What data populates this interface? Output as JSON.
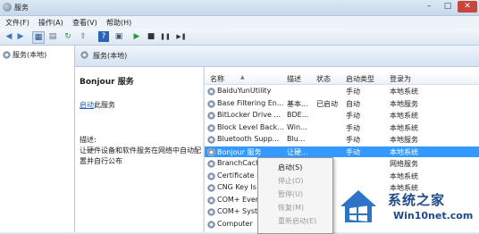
{
  "window": {
    "title": "服务",
    "controls": [
      "–",
      "□",
      "✕"
    ]
  },
  "menu": [
    {
      "label": "文件(F)"
    },
    {
      "label": "操作(A)"
    },
    {
      "label": "查看(V)"
    },
    {
      "label": "帮助(H)"
    }
  ],
  "toolbar": {
    "icons": [
      "back-arrow-icon",
      "forward-arrow-icon",
      "console-tree-icon",
      "show-hide-icon",
      "refresh-icon",
      "export-icon",
      "help-icon",
      "properties-icon",
      "play-icon",
      "stop-icon",
      "pause-icon",
      "restart-icon"
    ],
    "glyphs": [
      "◀",
      "▶",
      "▦",
      "▤",
      "↻",
      "⇪",
      "?",
      "▣",
      "▶",
      "■",
      "❚❚",
      "▶❚"
    ]
  },
  "tree": {
    "item_label": "服务(本地)"
  },
  "header": {
    "label": "服务(本地)"
  },
  "detail": {
    "service_name": "Bonjour 服务",
    "start_link": "启动",
    "start_suffix": "此服务",
    "description_label": "描述:",
    "description_text": "让硬件设备和软件服务在网络中自动配置并自行公布"
  },
  "columns": [
    "名称",
    "描述",
    "状态",
    "启动类型",
    "登录为"
  ],
  "services": [
    {
      "name": "BaiduYunUtility",
      "desc": "",
      "status": "",
      "startup": "手动",
      "logon": "本地系统"
    },
    {
      "name": "Base Filtering En...",
      "desc": "基本...",
      "status": "已启动",
      "startup": "自动",
      "logon": "本地服务"
    },
    {
      "name": "BitLocker Drive ...",
      "desc": "BDE...",
      "status": "",
      "startup": "手动",
      "logon": "本地系统"
    },
    {
      "name": "Block Level Back...",
      "desc": "Win...",
      "status": "",
      "startup": "手动",
      "logon": "本地系统"
    },
    {
      "name": "Bluetooth Supp...",
      "desc": "Blu...",
      "status": "",
      "startup": "手动",
      "logon": "本地服务"
    },
    {
      "name": "Bonjour 服务",
      "desc": "让硬...",
      "status": "",
      "startup": "手动",
      "logon": "本地系统"
    },
    {
      "name": "BranchCach",
      "desc": "",
      "status": "",
      "startup": "",
      "logon": "网络服务"
    },
    {
      "name": "Certificate P",
      "desc": "",
      "status": "",
      "startup": "",
      "logon": "本地系统"
    },
    {
      "name": "CNG Key Is",
      "desc": "",
      "status": "",
      "startup": "",
      "logon": "本地系统"
    },
    {
      "name": "COM+ Ever",
      "desc": "",
      "status": "",
      "startup": "",
      "logon": ""
    },
    {
      "name": "COM+ Syst",
      "desc": "",
      "status": "",
      "startup": "",
      "logon": ""
    },
    {
      "name": "Computer",
      "desc": "",
      "status": "",
      "startup": "",
      "logon": ""
    }
  ],
  "context_menu": [
    {
      "label": "启动(S)",
      "enabled": true
    },
    {
      "label": "停止(O)",
      "enabled": false
    },
    {
      "label": "暂停(U)",
      "enabled": false
    },
    {
      "label": "恢复(M)",
      "enabled": false
    },
    {
      "label": "重新启动(E)",
      "enabled": false
    }
  ],
  "watermark": {
    "title": "系统之家",
    "url": "Win10net.com"
  },
  "colors": {
    "selection": "#3399ff",
    "link": "#1f5fb5",
    "watermark": "#1d4a8c"
  }
}
